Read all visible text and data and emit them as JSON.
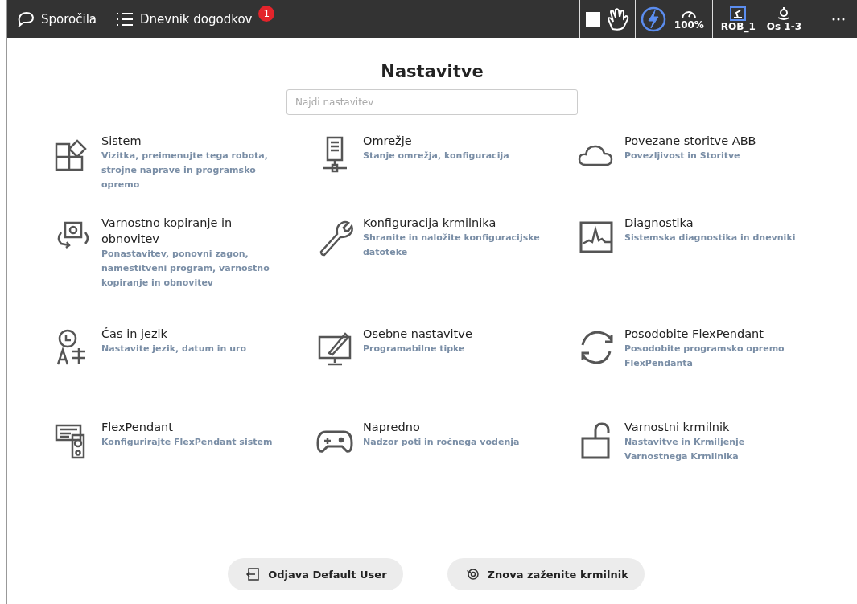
{
  "top_bar": {
    "messages": "Sporočila",
    "event_log": "Dnevnik dogodkov",
    "event_badge": "1",
    "speed": "100%",
    "mechanical_unit": "ROB_1",
    "axes": "Os 1-3"
  },
  "title": "Nastavitve",
  "search": {
    "placeholder": "Najdi nastavitev"
  },
  "settings": [
    {
      "title": "Sistem",
      "description": "Vizitka, preimenujte tega robota, strojne naprave in programsko opremo"
    },
    {
      "title": "Omrežje",
      "description": "Stanje omrežja, konfiguracija"
    },
    {
      "title": "Povezane storitve ABB",
      "description": "Povezljivost in Storitve"
    },
    {
      "title": "Varnostno kopiranje in obnovitev",
      "description": "Ponastavitev, ponovni zagon, namestitveni program, varnostno kopiranje in obnovitev"
    },
    {
      "title": "Konfiguracija krmilnika",
      "description": "Shranite in naložite konfiguracijske datoteke"
    },
    {
      "title": "Diagnostika",
      "description": "Sistemska diagnostika in dnevniki"
    },
    {
      "title": "Čas in jezik",
      "description": "Nastavite jezik, datum in uro"
    },
    {
      "title": "Osebne nastavitve",
      "description": "Programabilne tipke"
    },
    {
      "title": "Posodobite FlexPendant",
      "description": "Posodobite programsko opremo FlexPendanta"
    },
    {
      "title": "FlexPendant",
      "description": "Konfigurirajte FlexPendant sistem"
    },
    {
      "title": "Napredno",
      "description": "Nadzor poti in ročnega vodenja"
    },
    {
      "title": "Varnostni krmilnik",
      "description": "Nastavitve in Krmiljenje Varnostnega Krmilnika"
    }
  ],
  "buttons": [
    "Odjava Default User",
    "Znova zaženite krmilnik"
  ]
}
